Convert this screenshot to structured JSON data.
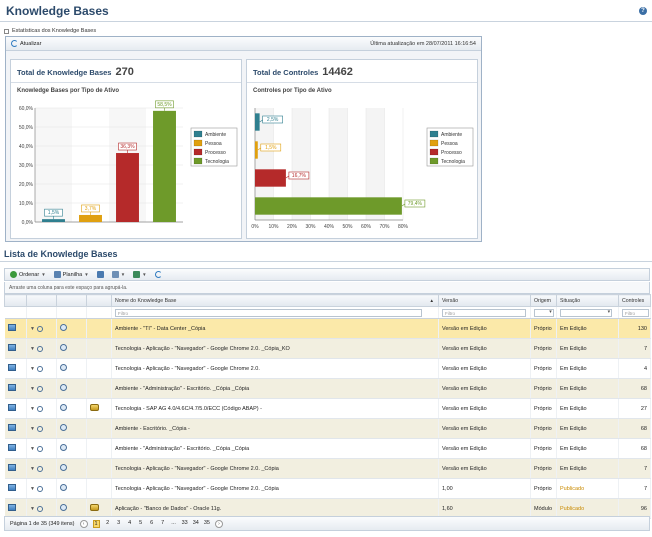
{
  "page": {
    "title": "Knowledge Bases",
    "help": "?"
  },
  "stats_toggle": {
    "label": "Estatísticas dos Knowledge Bases"
  },
  "stats_panel": {
    "refresh_label": "Atualizar",
    "last_update": "Última atualização em 28/07/2011 16:16:54",
    "kb_card": {
      "total_label": "Total de Knowledge Bases",
      "total_value": "270",
      "subtitle": "Knowledge Bases por Tipo de Ativo"
    },
    "ctrl_card": {
      "total_label": "Total de Controles",
      "total_value": "14462",
      "subtitle": "Controles por Tipo de Ativo"
    }
  },
  "colors": {
    "Ambiente": "#2f7f8f",
    "Pessoa": "#e0a010",
    "Processo": "#b52a2a",
    "Tecnologia": "#6e9a2a"
  },
  "chart_data": [
    {
      "type": "bar",
      "categories": [
        "Ambiente",
        "Pessoa",
        "Processo",
        "Tecnologia"
      ],
      "values": [
        1.5,
        3.7,
        36.3,
        58.5
      ],
      "data_labels": [
        "1,5%",
        "3,7%",
        "36,3%",
        "58,5%"
      ],
      "ylim": [
        0,
        60
      ],
      "yticks": [
        "0,0%",
        "10,0%",
        "20,0%",
        "30,0%",
        "40,0%",
        "50,0%",
        "60,0%"
      ],
      "legend": [
        "Ambiente",
        "Pessoa",
        "Processo",
        "Tecnologia"
      ],
      "legend_position": "right"
    },
    {
      "type": "bar",
      "orientation": "horizontal",
      "categories": [
        "Ambiente",
        "Pessoa",
        "Processo",
        "Tecnologia"
      ],
      "values": [
        2.5,
        1.5,
        16.7,
        79.4
      ],
      "data_labels": [
        "2,5%",
        "1,5%",
        "16,7%",
        "79,4%"
      ],
      "xlim": [
        0,
        80
      ],
      "xticks": [
        "0%",
        "10%",
        "20%",
        "30%",
        "40%",
        "50%",
        "60%",
        "70%",
        "80%"
      ],
      "legend": [
        "Ambiente",
        "Pessoa",
        "Processo",
        "Tecnologia"
      ],
      "legend_position": "right"
    }
  ],
  "list": {
    "title": "Lista de Knowledge Bases",
    "toolbar": {
      "order": "Ordenar",
      "sheet": "Planilha"
    },
    "group_hint": "Arraste uma coluna para este espaço para agrupá-la.",
    "columns": {
      "name": "Nome do Knowledge Base",
      "version": "Versão",
      "origin": "Origem",
      "situation": "Situação",
      "controls": "Controles"
    },
    "filter_placeholder": "Filtro",
    "rows": [
      {
        "name": "Ambiente - \"TI\" - Data Center _Cópia",
        "version": "Versão em Edição",
        "origin": "Próprio",
        "situation": "Em Edição",
        "controls": "130"
      },
      {
        "name": "Tecnologia - Aplicação - \"Navegador\" - Google Chrome 2.0. _Cópia_KO",
        "version": "Versão em Edição",
        "origin": "Próprio",
        "situation": "Em Edição",
        "controls": "7"
      },
      {
        "name": "Tecnologia - Aplicação - \"Navegador\" - Google Chrome 2.0.",
        "version": "Versão em Edição",
        "origin": "Próprio",
        "situation": "Em Edição",
        "controls": "4"
      },
      {
        "name": "Ambiente - \"Administração\" - Escritório. _Cópia _Cópia",
        "version": "Versão em Edição",
        "origin": "Próprio",
        "situation": "Em Edição",
        "controls": "68"
      },
      {
        "name": "Tecnologia - SAP AG 4.0/4.6C/4.7/5.0/ECC (Código ABAP) -",
        "version": "Versão em Edição",
        "origin": "Próprio",
        "situation": "Em Edição",
        "controls": "27"
      },
      {
        "name": "Ambiente - Escritório. _Cópia -",
        "version": "Versão em Edição",
        "origin": "Próprio",
        "situation": "Em Edição",
        "controls": "68"
      },
      {
        "name": "Ambiente - \"Administração\" - Escritório. _Cópia _Cópia",
        "version": "Versão em Edição",
        "origin": "Próprio",
        "situation": "Em Edição",
        "controls": "68"
      },
      {
        "name": "Tecnologia - Aplicação - \"Navegador\" - Google Chrome 2.0. _Cópia",
        "version": "Versão em Edição",
        "origin": "Próprio",
        "situation": "Em Edição",
        "controls": "7"
      },
      {
        "name": "Tecnologia - Aplicação - \"Navegador\" - Google Chrome 2.0. _Cópia",
        "version": "1,00",
        "origin": "Próprio",
        "situation": "Publicado",
        "controls": "7"
      },
      {
        "name": "Aplicação - \"Banco de Dados\" - Oracle 11g.",
        "version": "1,60",
        "origin": "Módulo",
        "situation": "Publicado",
        "controls": "96"
      }
    ],
    "pager": {
      "summary": "Página 1 de 35 (349 itens)",
      "pages": [
        "1",
        "2",
        "3",
        "4",
        "5",
        "6",
        "7",
        "...",
        "33",
        "34",
        "35"
      ]
    }
  }
}
